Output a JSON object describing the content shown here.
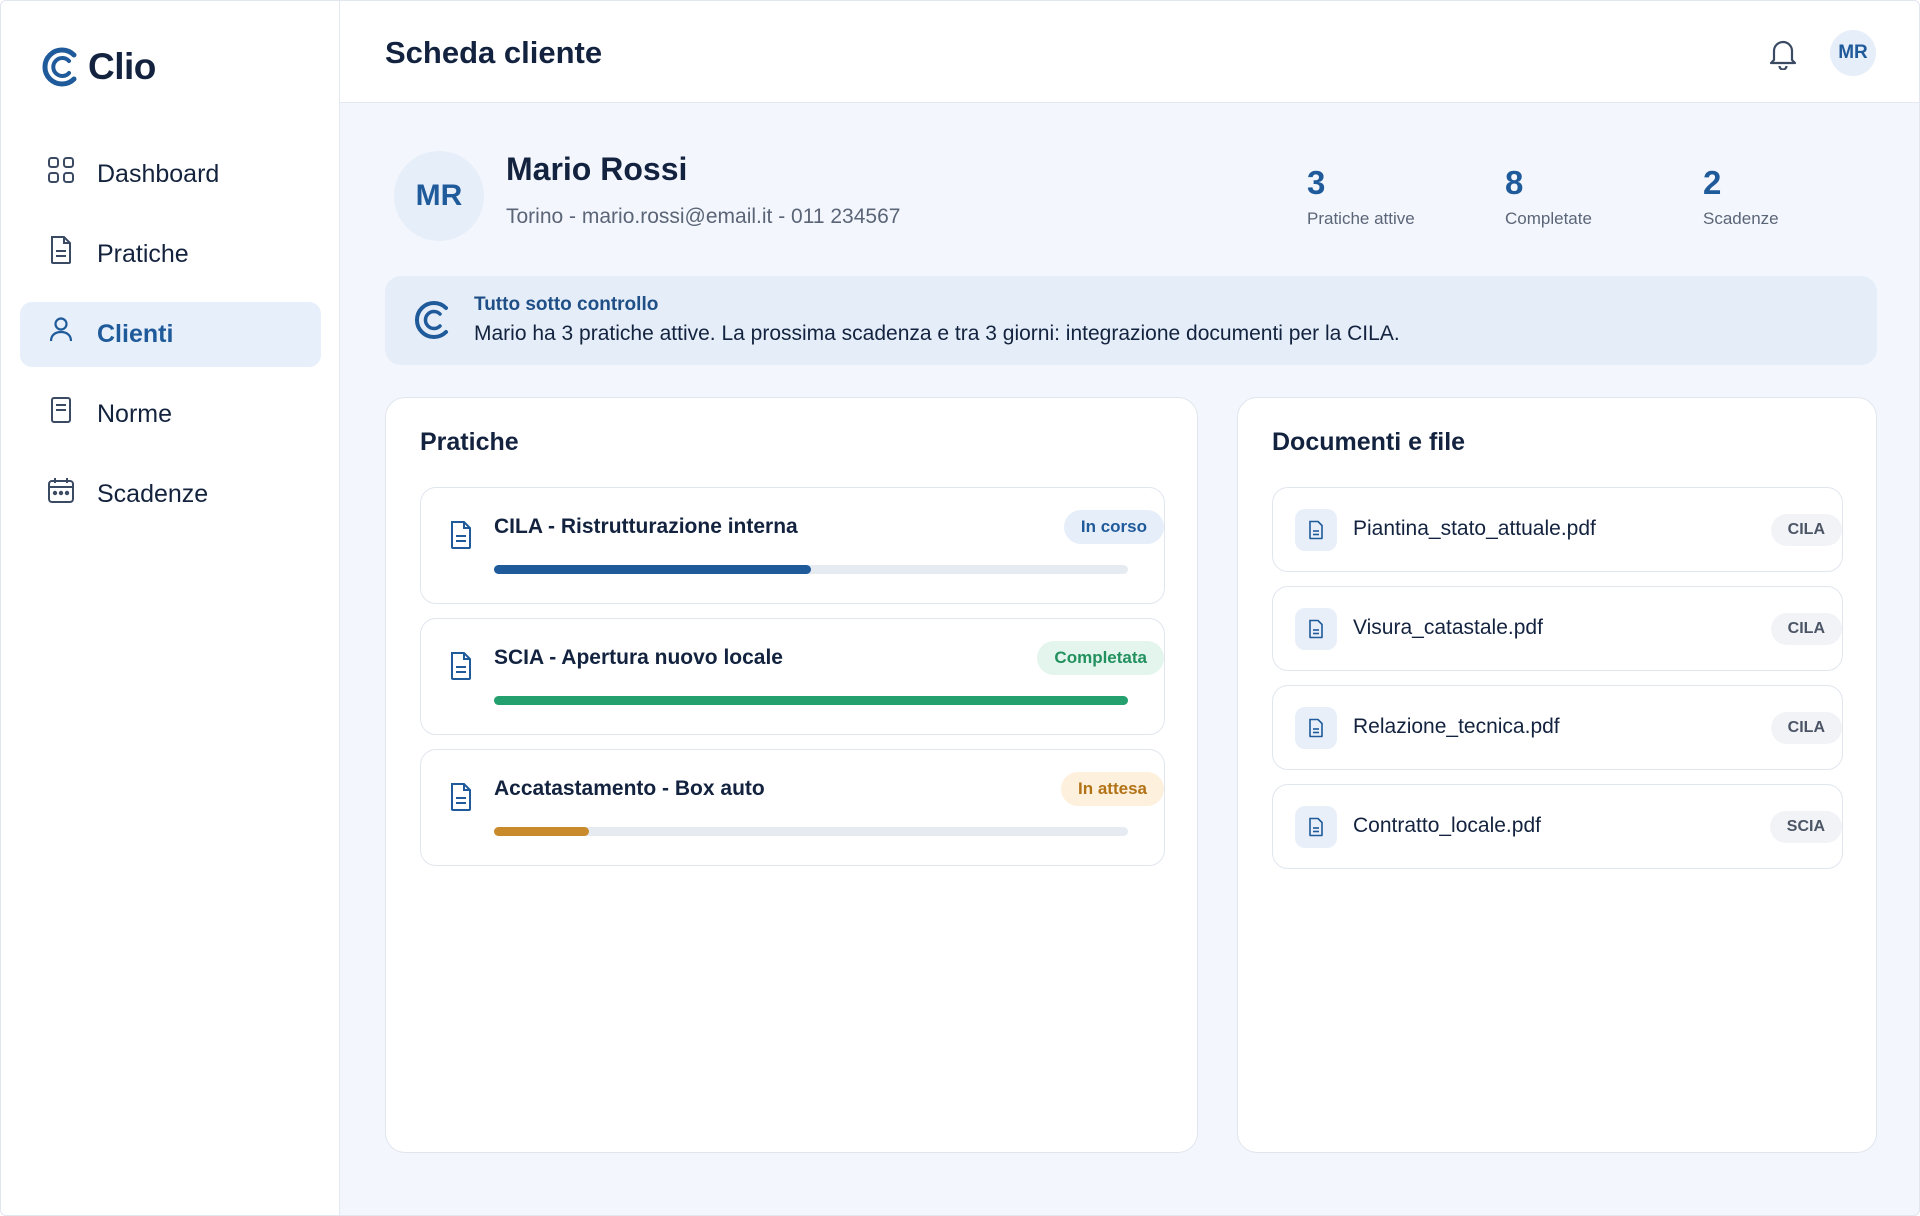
{
  "app": {
    "name": "Clio"
  },
  "sidebar": {
    "items": [
      {
        "label": "Dashboard",
        "icon": "grid-icon",
        "active": false
      },
      {
        "label": "Pratiche",
        "icon": "document-icon",
        "active": false
      },
      {
        "label": "Clienti",
        "icon": "user-icon",
        "active": true
      },
      {
        "label": "Norme",
        "icon": "book-icon",
        "active": false
      },
      {
        "label": "Scadenze",
        "icon": "calendar-icon",
        "active": false
      }
    ]
  },
  "header": {
    "title": "Scheda cliente",
    "avatar_initials": "MR"
  },
  "client": {
    "initials": "MR",
    "name": "Mario Rossi",
    "info": "Torino - mario.rossi@email.it - 011 234567",
    "stats": [
      {
        "value": "3",
        "label": "Pratiche attive"
      },
      {
        "value": "8",
        "label": "Completate"
      },
      {
        "value": "2",
        "label": "Scadenze"
      }
    ]
  },
  "banner": {
    "title": "Tutto sotto controllo",
    "text": "Mario ha 3 pratiche attive. La prossima scadenza e tra 3 giorni: integrazione documenti per la CILA."
  },
  "pratiche": {
    "title": "Pratiche",
    "items": [
      {
        "title": "CILA - Ristrutturazione interna",
        "status": "In corso",
        "progress": 0.5,
        "color": "#1f5a9a",
        "badge_bg": "#e6eef9",
        "badge_fg": "#1f5a9a"
      },
      {
        "title": "SCIA - Apertura nuovo locale",
        "status": "Completata",
        "progress": 1.0,
        "color": "#23a06e",
        "badge_bg": "#e3f5ec",
        "badge_fg": "#23915f"
      },
      {
        "title": "Accatastamento - Box auto",
        "status": "In attesa",
        "progress": 0.15,
        "color": "#c98a2c",
        "badge_bg": "#fdf0dc",
        "badge_fg": "#b27216"
      }
    ]
  },
  "documenti": {
    "title": "Documenti e file",
    "items": [
      {
        "name": "Piantina_stato_attuale.pdf",
        "tag": "CILA"
      },
      {
        "name": "Visura_catastale.pdf",
        "tag": "CILA"
      },
      {
        "name": "Relazione_tecnica.pdf",
        "tag": "CILA"
      },
      {
        "name": "Contratto_locale.pdf",
        "tag": "SCIA"
      }
    ]
  }
}
